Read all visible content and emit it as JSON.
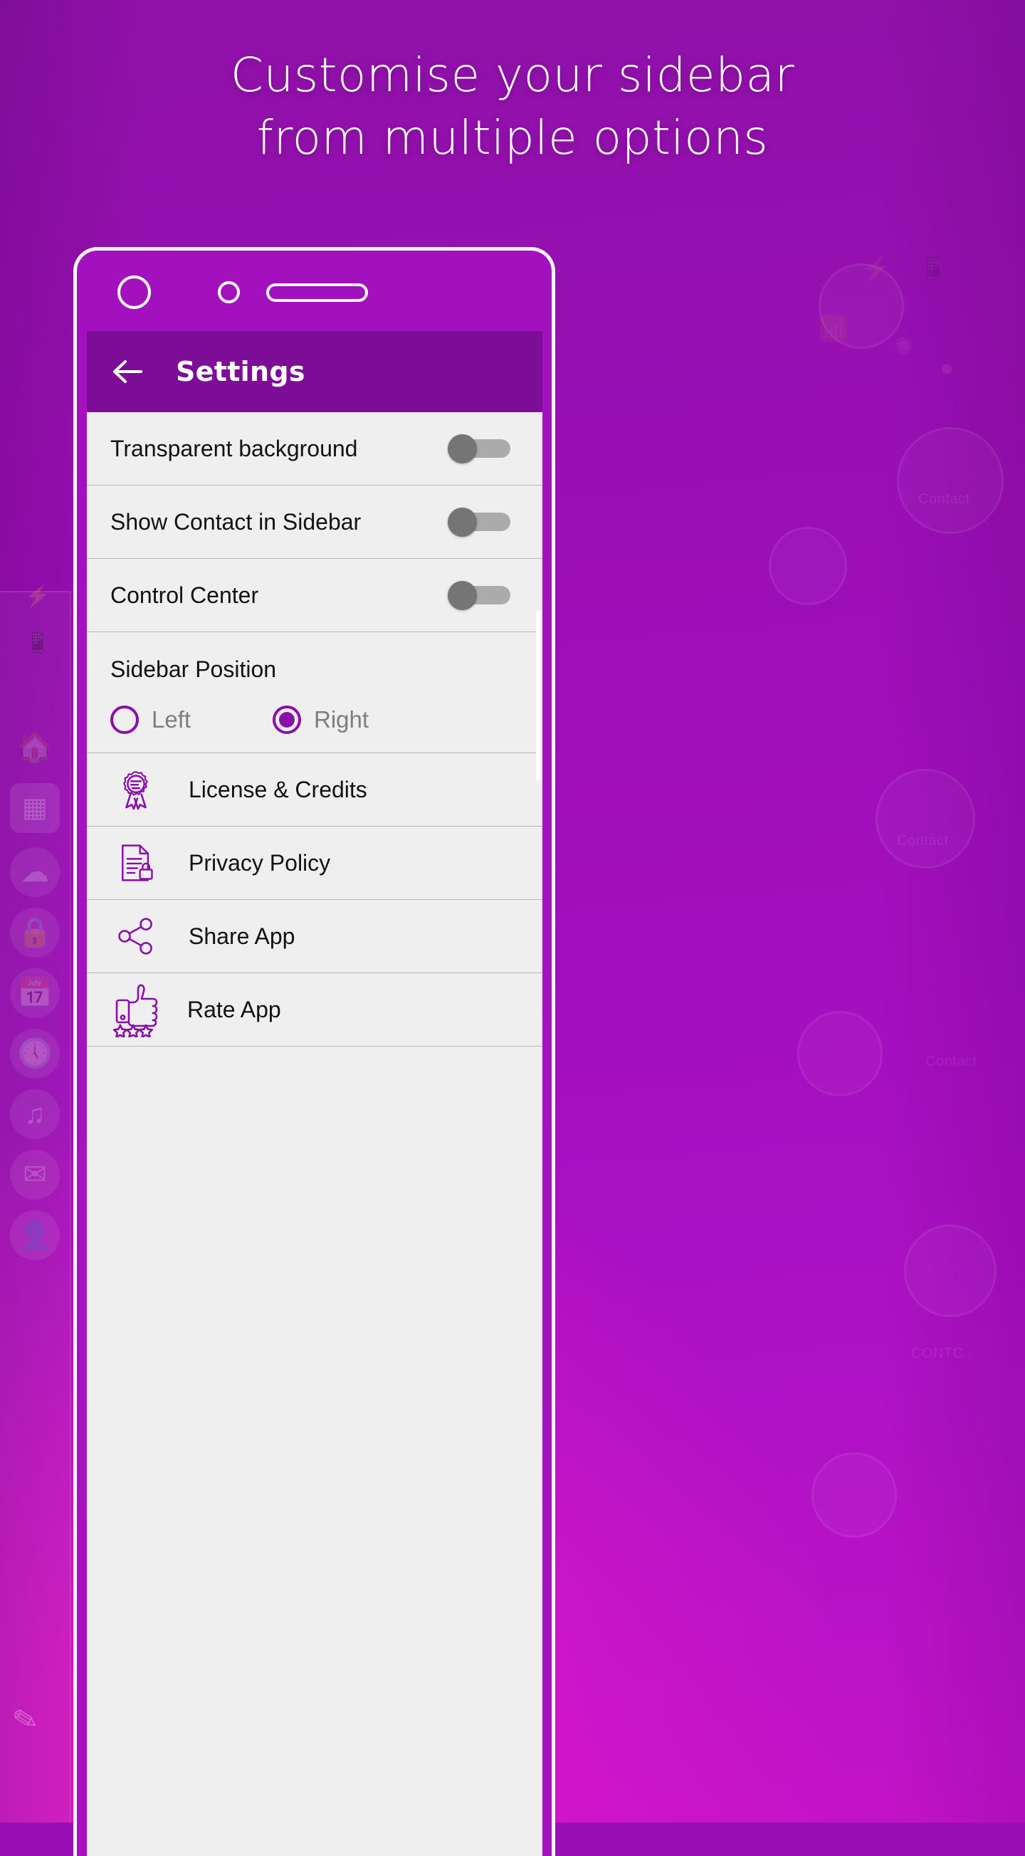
{
  "headline": {
    "line1": "Customise your sidebar",
    "line2": "from multiple options"
  },
  "colors": {
    "background_purple": "#9A0FB5",
    "appbar_purple": "#7D0C96",
    "accent_purple": "#8A0FA8",
    "screen_background": "#EFEFEF",
    "toggle_track": "#ABABAB",
    "toggle_thumb": "#757575",
    "label_text": "#121212",
    "radio_label_text": "#7E7E7E"
  },
  "phone": {
    "status": {
      "camera_large": "camera-icon",
      "camera_small": "sensor-icon",
      "speaker": "speaker-grille"
    }
  },
  "appbar": {
    "back_icon": "arrow-left-icon",
    "title": "Settings"
  },
  "toggles": [
    {
      "label": "Transparent background",
      "state": "off"
    },
    {
      "label": "Show Contact in Sidebar",
      "state": "off"
    },
    {
      "label": "Control Center",
      "state": "off"
    }
  ],
  "sidebar_position": {
    "title": "Sidebar Position",
    "options": [
      {
        "label": "Left",
        "selected": false
      },
      {
        "label": "Right",
        "selected": true
      }
    ]
  },
  "menu_items": [
    {
      "label": "License & Credits",
      "icon": "award-ribbon-icon"
    },
    {
      "label": "Privacy Policy",
      "icon": "document-lock-icon"
    },
    {
      "label": "Share App",
      "icon": "share-nodes-icon"
    },
    {
      "label": "Rate App",
      "icon": "thumbs-up-stars-icon"
    }
  ],
  "background_decor": {
    "sidebar_icons": [
      "home-icon",
      "apps-grid-icon",
      "cloud-icon",
      "lock-icon",
      "calendar-icon",
      "clock-icon",
      "music-icon",
      "mail-icon",
      "contacts-icon"
    ],
    "edit_icon": "pencil-icon",
    "top_icons": [
      "flash-off-icon",
      "vibrate-icon",
      "wifi-icon",
      "close-icon"
    ],
    "ghost_words": [
      "Contact",
      "Contact",
      "Contact",
      "CONTC.."
    ]
  }
}
